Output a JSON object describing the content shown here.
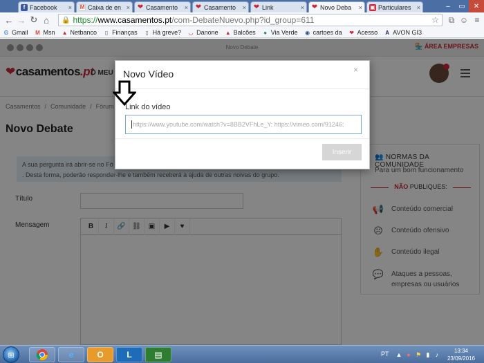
{
  "browser": {
    "tabs": [
      {
        "label": "Facebook",
        "icon": "facebook-icon",
        "active": false
      },
      {
        "label": "Caixa de en",
        "icon": "gmail-icon",
        "active": false
      },
      {
        "label": "Casamento",
        "icon": "heart-icon",
        "active": false
      },
      {
        "label": "Casamento",
        "icon": "heart-icon",
        "active": false
      },
      {
        "label": "Link",
        "icon": "heart-icon",
        "active": false
      },
      {
        "label": "Novo Deba",
        "icon": "heart-icon",
        "active": true
      },
      {
        "label": "Particulares",
        "icon": "particulares-icon",
        "active": false
      }
    ],
    "url": {
      "scheme": "https://",
      "host": "www.casamentos.pt",
      "path": "/com-DebateNuevo.php?id_group=611"
    },
    "bookmarks": [
      {
        "label": "Gmail",
        "icon": "g-icon",
        "color": "#4285f4"
      },
      {
        "label": "Msn",
        "icon": "msn-icon",
        "color": "#d44638"
      },
      {
        "label": "Netbanco",
        "icon": "netbanco-icon",
        "color": "#c92a3a"
      },
      {
        "label": "Finanças",
        "icon": "document-icon",
        "color": "#666666"
      },
      {
        "label": "Há greve?",
        "icon": "document-icon",
        "color": "#666666"
      },
      {
        "label": "Danone",
        "icon": "danone-icon",
        "color": "#c92a3a"
      },
      {
        "label": "Balcões",
        "icon": "netbanco-icon",
        "color": "#c92a3a"
      },
      {
        "label": "Via Verde",
        "icon": "viaverde-icon",
        "color": "#2e8b57"
      },
      {
        "label": "cartoes da",
        "icon": "globe-icon",
        "color": "#2a4f86"
      },
      {
        "label": "Acesso",
        "icon": "heart-icon",
        "color": "#c92a3a"
      },
      {
        "label": "AVON GI3",
        "icon": "avon-icon",
        "color": "#1b2d6b"
      }
    ]
  },
  "site": {
    "topstrip_title": "Novo Debate",
    "area_empresas": "ÁREA EMPRESAS",
    "logo": {
      "main": "casamentos",
      "suffix": ".pt"
    },
    "menu_link": "O MEU C",
    "breadcrumb": [
      "Casamentos",
      "/",
      "Comunidade",
      "/",
      "Fórum S"
    ],
    "page_title": "Novo Debate",
    "info_text_line1": "A sua pergunta irá abrir-se no Fó",
    "info_text_line2": ". Desta forma, poderão responder-lhe e também receberá a ajuda de outras noivas do grupo.",
    "title_label": "Título",
    "message_label": "Mensagem",
    "editor_tools": [
      {
        "label": "B",
        "icon": "bold-icon"
      },
      {
        "label": "I",
        "icon": "italic-icon"
      },
      {
        "label": "🔗",
        "icon": "link-icon"
      },
      {
        "label": "⛓",
        "icon": "unlink-icon"
      },
      {
        "label": "▣",
        "icon": "image-icon"
      },
      {
        "label": "▶",
        "icon": "video-icon"
      },
      {
        "label": "♥",
        "icon": "heart-icon"
      }
    ],
    "rules": {
      "title": "NORMAS DA COMUNIDADE",
      "subtitle": "Para um bom funcionamento",
      "not_prefix": "NÃO",
      "not_suffix": "PUBLIQUES:",
      "items": [
        {
          "label": "Conteúdo comercial",
          "icon": "megaphone-icon"
        },
        {
          "label": "Conteúdo ofensivo",
          "icon": "sad-face-icon"
        },
        {
          "label": "Conteúdo ilegal",
          "icon": "stop-hand-icon"
        },
        {
          "label": "Ataques a pessoas, empresas ou usuários",
          "icon": "speech-bubble-icon"
        }
      ]
    }
  },
  "modal": {
    "title": "Novo Vídeo",
    "close": "×",
    "field_label": "Link do vídeo",
    "placeholder": "https://www.youtube.com/watch?v=8BB2VFhLe_Y; https://vimeo.com/91246;",
    "button": "Inserir"
  },
  "taskbar": {
    "language": "PT",
    "time": "13:34",
    "date": "23/09/2016"
  }
}
